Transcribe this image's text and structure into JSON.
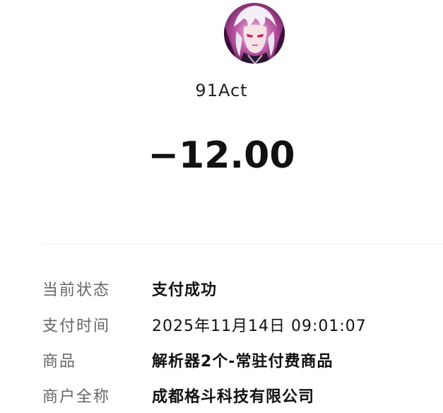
{
  "merchant": {
    "avatar_icon": "anime-character-avatar",
    "name": "91Act"
  },
  "payment": {
    "amount": "−12.00"
  },
  "details": [
    {
      "label": "当前状态",
      "value": "支付成功"
    },
    {
      "label": "支付时间",
      "value": "2025年11月14日 09:01:07"
    },
    {
      "label": "商品",
      "value": "解析器2个-常驻付费商品"
    },
    {
      "label": "商户全称",
      "value": "成都格斗科技有限公司"
    }
  ],
  "colors": {
    "label": "#666666",
    "value": "#111111",
    "divider": "#eeeeee",
    "background": "#ffffff"
  }
}
